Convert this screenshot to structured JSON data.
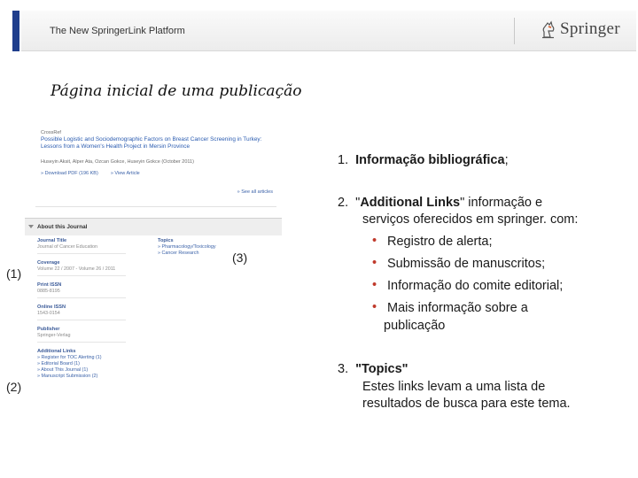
{
  "header": {
    "title": "The New SpringerLink Platform",
    "logo_text": "Springer",
    "logo_icon": "springer-knight-icon",
    "accent_color": "#1f3e8c"
  },
  "slide_title": "Página  inicial de uma publicação",
  "article": {
    "source": "CrossRef",
    "title": "Possible Logistic and Sociodemographic Factors on Breast Cancer Screening in Turkey: Lessons from a Women's Health Project in Mersin Province",
    "authors": "Huseyin Aksit, Alper Ata, Ozcan Gokce, Huseyin Gokce (October 2011)",
    "download_label": "» Download PDF (196 KB)",
    "view_label": "» View Article",
    "see_all": "» See all articles"
  },
  "about": {
    "heading": "About this Journal",
    "fields": [
      {
        "label": "Journal Title",
        "value": "Journal of Cancer Education"
      },
      {
        "label": "Coverage",
        "value": "Volume 22 / 2007 - Volume 26 / 2011"
      },
      {
        "label": "Print ISSN",
        "value": "0885-8195"
      },
      {
        "label": "Online ISSN",
        "value": "1543-0154"
      },
      {
        "label": "Publisher",
        "value": "Springer-Verlag"
      }
    ],
    "additional_links_label": "Additional Links",
    "additional_links": [
      "» Register for TOC Alerting (1)",
      "» Editorial Board (1)",
      "» About This Journal (1)",
      "» Manuscript Submission (2)"
    ],
    "topics_label": "Topics",
    "topics": [
      "» Pharmacology/Toxicology",
      "» Cancer Research"
    ]
  },
  "markers": {
    "one": "(1)",
    "two": "(2)",
    "three": "(3)"
  },
  "list": {
    "item1_num": "1.",
    "item1_bold": "Informação bibliográfica",
    "item1_tail": ";",
    "item2_num": "2.",
    "item2_line1_pre": "\"",
    "item2_bold": "Additional Links",
    "item2_line1_post": "\" informação e",
    "item2_line2": "serviços oferecidos em springer. com:",
    "bullets": [
      "Registro de alerta;",
      "Submissão de manuscritos;",
      "Informação do comite editorial;",
      "Mais informação sobre a"
    ],
    "bullet4_cont": "publicação",
    "item3_num": "3.",
    "item3_bold": "\"Topics\"",
    "item3_line1": "Estes links levam a uma lista de",
    "item3_line2": "resultados de busca para este tema."
  }
}
